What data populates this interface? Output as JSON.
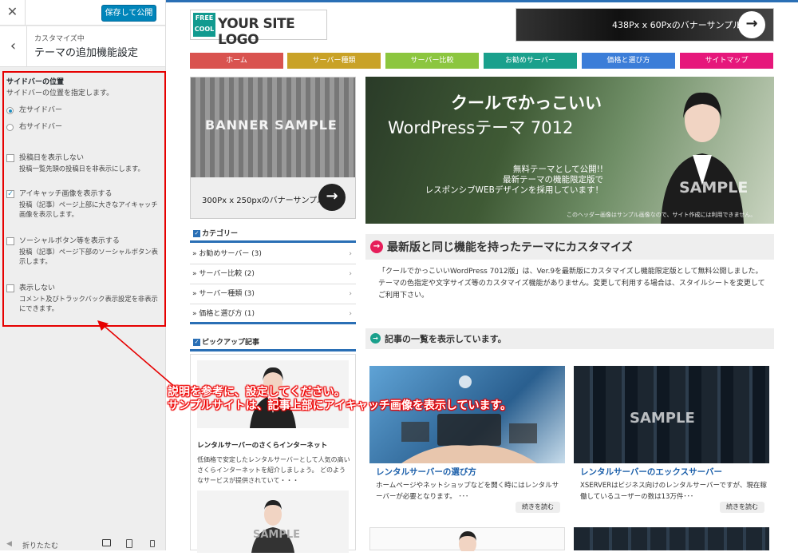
{
  "panel": {
    "close_icon": "✕",
    "save_label": "保存して公開",
    "back_icon": "‹",
    "subtitle": "カスタマイズ中",
    "title": "テーマの追加機能設定",
    "section_title": "サイドバーの位置",
    "section_desc": "サイドバーの位置を指定します。",
    "radio_left": "左サイドバー",
    "radio_right": "右サイドバー",
    "opt1_label": "投稿日を表示しない",
    "opt1_desc": "投稿一覧先頭の投稿日を非表示にします。",
    "opt2_label": "アイキャッチ画像を表示する",
    "opt2_desc": "投稿（記事）ページ上部に大きなアイキャッチ画像を表示します。",
    "opt3_label": "ソーシャルボタン等を表示する",
    "opt3_desc": "投稿（記事）ページ下部のソーシャルボタン表示します。",
    "opt4_label": "表示しない",
    "opt4_desc": "コメント及びトラックバック表示設定を非表示にできます。",
    "collapse_label": "折りたたむ"
  },
  "site": {
    "logo_badge_1": "FREE",
    "logo_badge_2": "COOL",
    "logo_text": "YOUR SITE LOGO",
    "header_banner": "438Px x 60Pxのバナーサンプル",
    "nav": [
      {
        "label": "ホーム",
        "color": "#d9534f"
      },
      {
        "label": "サーバー種類",
        "color": "#c9a227"
      },
      {
        "label": "サーバー比較",
        "color": "#8cc63f"
      },
      {
        "label": "お勧めサーバー",
        "color": "#1aa08c"
      },
      {
        "label": "価格と選び方",
        "color": "#3b7dd8"
      },
      {
        "label": "サイトマップ",
        "color": "#e6177b"
      }
    ],
    "banner_sample": "BANNER SAMPLE",
    "banner_label": "300Px x 250pxのバナーサンプル",
    "hero_title1": "クールでかっこいい",
    "hero_title2": "WordPressテーマ 7012",
    "hero_p1": "無料テーマとして公開!!",
    "hero_p2": "最新テーマの機能限定版で",
    "hero_p3": "レスポンシブWEBデザインを採用しています！",
    "hero_sample": "SAMPLE",
    "hero_note": "このヘッダー画像はサンプル画像なので、サイト作成には利用できません。",
    "cat_title": "カテゴリー",
    "categories": [
      "お勧めサーバー (3)",
      "サーバー比較 (2)",
      "サーバー種類 (3)",
      "価格と選び方 (1)"
    ],
    "h2_title": "最新版と同じ機能を持ったテーマにカスタマイズ",
    "body_text": "「クールでかっこいいWordPress 7012版」は、Ver.9を最新版にカスタマイズし機能限定版として無料公開しました。\nテーマの色指定や文字サイズ等のカスタマイズ機能がありません。変更して利用する場合は、スタイルシートを変更してご利用下さい。",
    "h3_title": "記事の一覧を表示しています。",
    "pick_title": "ピックアップ記事",
    "pick_item_title": "レンタルサーバーのさくらインターネット",
    "pick_item_desc": "低価格で安定したレンタルサーバーとして人気の高いさくらインターネットを紹介しましょう。 どのようなサービスが提供されていて・・・",
    "card1_title": "レンタルサーバーの選び方",
    "card1_desc": "ホームページやネットショップなどを開く時にはレンタルサーバーが必要となります。 ･･･",
    "card2_title": "レンタルサーバーのエックスサーバー",
    "card2_desc": "XSERVERはビジネス向けのレンタルサーバーですが、現在稼働しているユーザーの数は13万件･･･",
    "more_label": "続きを読む",
    "sample_text": "SAMPLE"
  },
  "annotation": {
    "line1": "説明を参考に、設定してください。",
    "line2": "サンプルサイトは、記事上部にアイキャッチ画像を表示しています。"
  }
}
